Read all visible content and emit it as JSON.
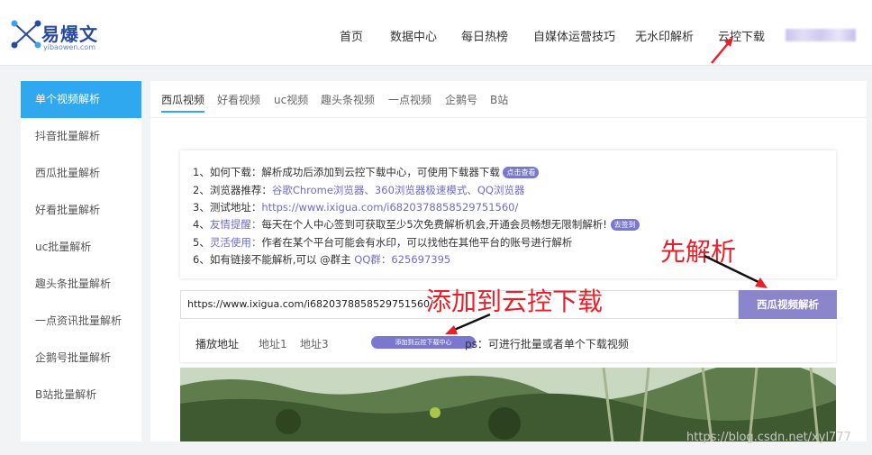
{
  "logo": {
    "name": "易爆文",
    "sub": "yibaowen.com"
  },
  "nav": [
    {
      "label": "首页"
    },
    {
      "label": "数据中心"
    },
    {
      "label": "每日热榜"
    },
    {
      "label": "自媒体运营技巧"
    },
    {
      "label": "无水印解析"
    },
    {
      "label": "云控下载"
    }
  ],
  "sidebar": [
    {
      "label": "单个视频解析",
      "active": true
    },
    {
      "label": "抖音批量解析"
    },
    {
      "label": "西瓜批量解析"
    },
    {
      "label": "好看批量解析"
    },
    {
      "label": "uc批量解析"
    },
    {
      "label": "趣头条批量解析"
    },
    {
      "label": "一点资讯批量解析"
    },
    {
      "label": "企鹅号批量解析"
    },
    {
      "label": "B站批量解析"
    }
  ],
  "tabs": [
    {
      "label": "西瓜视频",
      "active": true
    },
    {
      "label": "好看视频"
    },
    {
      "label": "uc视频"
    },
    {
      "label": "趣头条视频"
    },
    {
      "label": "一点视频"
    },
    {
      "label": "企鹅号"
    },
    {
      "label": "B站"
    }
  ],
  "notice": {
    "l1_text": "1、如何下载：解析成功后添加到云控下载中心，可使用下载器下载",
    "l1_pill": "点击查看",
    "l2_pre": "2、浏览器推荐：",
    "l2_links": "谷歌Chrome浏览器、360浏览器极速模式、QQ浏览器",
    "l3_pre": "3、测试地址：",
    "l3_link": "https://www.ixigua.com/i6820378858529751560/",
    "l4_pre": "4、",
    "l4_hl": "友情提醒：",
    "l4_text": "每天在个人中心签到可获取至少5次免费解析机会,开通会员畅想无限制解析!",
    "l4_pill": "去签到",
    "l5_pre": "5、",
    "l5_hl": "灵活使用：",
    "l5_text": "作者在某个平台可能会有水印，可以找他在其他平台的账号进行解析",
    "l6_text": "6、如有链接不能解析,可以 @群主 ",
    "l6_link": "QQ群：625697395"
  },
  "input": {
    "value": "https://www.ixigua.com/i6820378858529751560/"
  },
  "parse_button": "西瓜视频解析",
  "play": {
    "label": "播放地址",
    "addr1": "地址1",
    "addr3": "地址3",
    "add_button": "添加到云控下载中心",
    "ps": "ps：可进行批量或者单个下载视频"
  },
  "annotations": {
    "first": "先解析",
    "second": "添加到云控下载"
  },
  "watermark": "https://blog.csdn.net/xyl777",
  "colors": {
    "accent": "#2fa8f0",
    "purple": "#7b77d0",
    "annotation": "#e8202a"
  }
}
